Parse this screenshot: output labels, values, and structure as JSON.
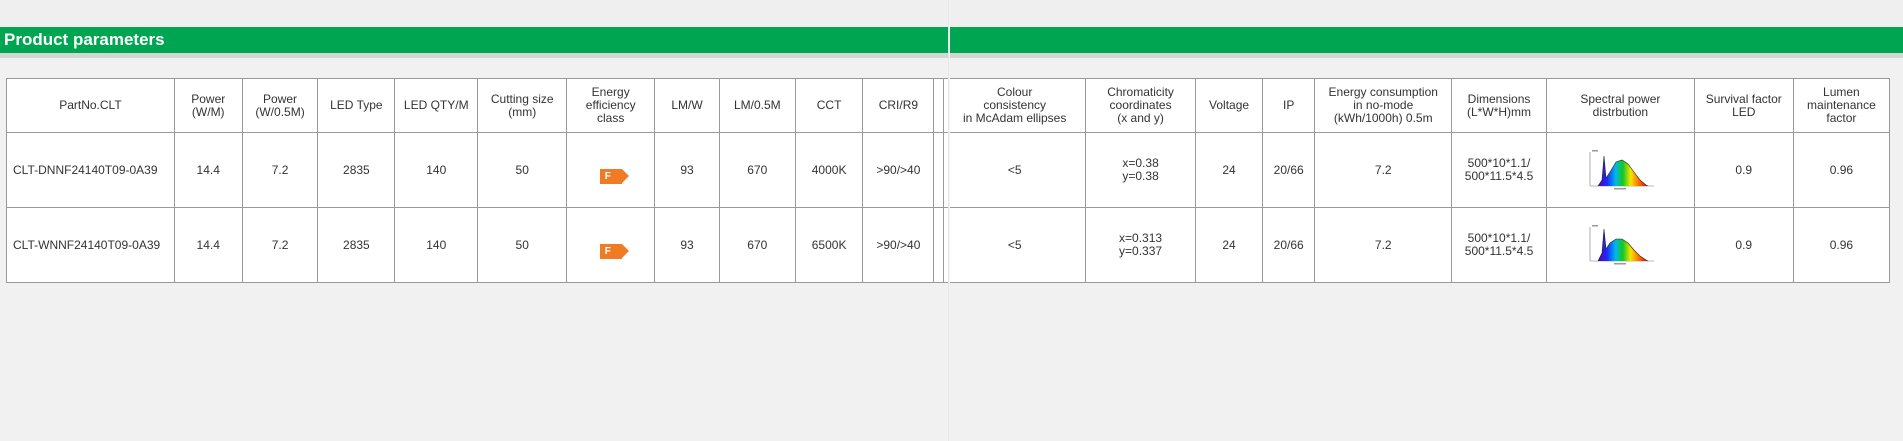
{
  "banner": {
    "title": "Product parameters"
  },
  "table": {
    "headers": [
      "PartNo.CLT",
      "Power\n(W/M)",
      "Power\n(W/0.5M)",
      "LED Type",
      "LED QTY/M",
      "Cutting size\n(mm)",
      "Energy\nefficiency\nclass",
      "LM/W",
      "LM/0.5M",
      "CCT",
      "CRI/R9",
      "",
      "Colour\nconsistency\nin McAdam ellipses",
      "Chromaticity\ncoordinates\n(x and y)",
      "Voltage",
      "IP",
      "Energy consumption\nin no-mode\n(kWh/1000h) 0.5m",
      "Dimensions\n(L*W*H)mm",
      "Spectral power\ndistrbution",
      "Survival factor\nLED",
      "Lumen\nmaintenance\nfactor"
    ],
    "rows": [
      {
        "part_no": "CLT-DNNF24140T09-0A39",
        "power_w_m": "14.4",
        "power_w_05m": "7.2",
        "led_type": "2835",
        "led_qty_m": "140",
        "cutting_size": "50",
        "energy_class": "F",
        "lm_w": "93",
        "lm_05m": "670",
        "cct": "4000K",
        "cri_r9": ">90/>40",
        "colour_consistency": "<5",
        "chromaticity": "x=0.38\ny=0.38",
        "voltage": "24",
        "ip": "20/66",
        "energy_consumption": "7.2",
        "dimensions": "500*10*1.1/\n500*11.5*4.5",
        "spectral_icon": "spectrum-graph-icon",
        "survival_factor": "0.9",
        "lumen_maintenance": "0.96"
      },
      {
        "part_no": "CLT-WNNF24140T09-0A39",
        "power_w_m": "14.4",
        "power_w_05m": "7.2",
        "led_type": "2835",
        "led_qty_m": "140",
        "cutting_size": "50",
        "energy_class": "F",
        "lm_w": "93",
        "lm_05m": "670",
        "cct": "6500K",
        "cri_r9": ">90/>40",
        "colour_consistency": "<5",
        "chromaticity": "x=0.313\ny=0.337",
        "voltage": "24",
        "ip": "20/66",
        "energy_consumption": "7.2",
        "dimensions": "500*10*1.1/\n500*11.5*4.5",
        "spectral_icon": "spectrum-graph-icon",
        "survival_factor": "0.9",
        "lumen_maintenance": "0.96"
      }
    ]
  },
  "colors": {
    "banner_green": "#00a551",
    "energy_badge": "#f07b26",
    "grid_line": "#9a9a9a",
    "background": "#efefef"
  }
}
